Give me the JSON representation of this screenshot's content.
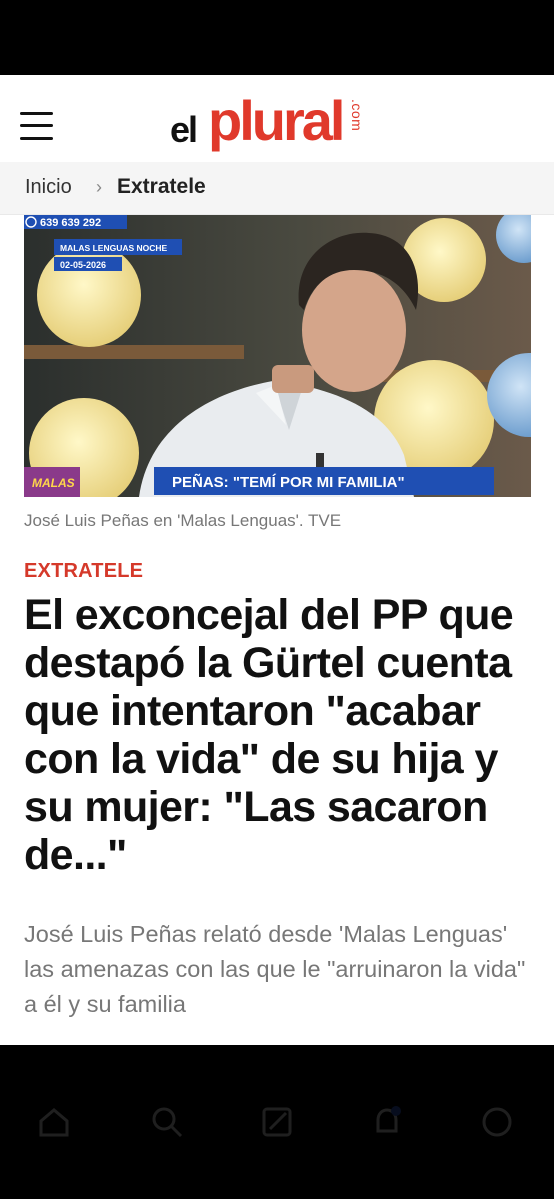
{
  "header": {
    "logo_el": "el",
    "logo_plural": "plural",
    "logo_com": ".com"
  },
  "breadcrumb": {
    "home": "Inicio",
    "separator": "›",
    "current": "Extratele"
  },
  "hero": {
    "phone": "639 639 292",
    "show_name": "MALAS LENGUAS NOCHE",
    "date": "02-05-2026",
    "lower_third": "PEÑAS: \"TEMÍ POR MI FAMILIA\"",
    "corner_logo": "MALAS"
  },
  "caption": "José Luis Peñas en 'Malas Lenguas'. TVE",
  "article": {
    "section": "EXTRATELE",
    "headline": "El exconcejal del PP que destapó la Gürtel cuenta que intentaron \"acabar con la vida\" de su hija y su mujer: \"Las sacaron de...\"",
    "subtitle": "José Luis Peñas relató desde 'Malas Lenguas' las amenazas con las que le \"arruinaron la vida\" a él y su familia"
  },
  "colors": {
    "accent": "#e0392b",
    "section": "#d5392a",
    "text": "#111111",
    "muted": "#777777",
    "tve_blue": "#1f4fb3"
  },
  "icons": [
    "menu-icon",
    "chevron-right-icon",
    "phone-icon",
    "home-icon",
    "search-icon",
    "edit-icon",
    "bell-icon",
    "profile-icon"
  ]
}
